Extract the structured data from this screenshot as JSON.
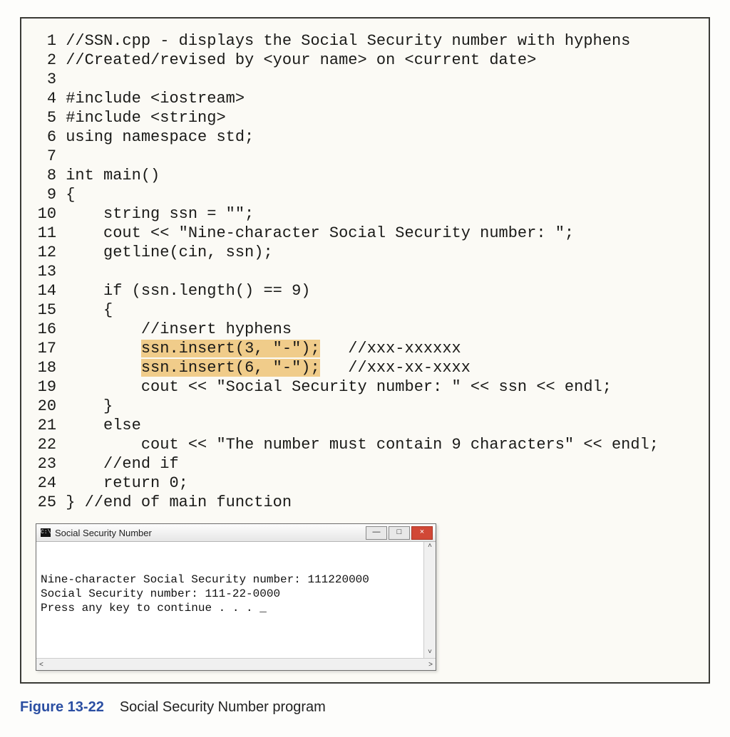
{
  "code": {
    "lines": [
      {
        "n": "1",
        "text": "//SSN.cpp - displays the Social Security number with hyphens"
      },
      {
        "n": "2",
        "text": "//Created/revised by <your name> on <current date>"
      },
      {
        "n": "3",
        "text": ""
      },
      {
        "n": "4",
        "text": "#include <iostream>"
      },
      {
        "n": "5",
        "text": "#include <string>"
      },
      {
        "n": "6",
        "text": "using namespace std;"
      },
      {
        "n": "7",
        "text": ""
      },
      {
        "n": "8",
        "text": "int main()"
      },
      {
        "n": "9",
        "text": "{"
      },
      {
        "n": "10",
        "text": "    string ssn = \"\";"
      },
      {
        "n": "11",
        "text": "    cout << \"Nine-character Social Security number: \";"
      },
      {
        "n": "12",
        "text": "    getline(cin, ssn);"
      },
      {
        "n": "13",
        "text": ""
      },
      {
        "n": "14",
        "text": "    if (ssn.length() == 9)"
      },
      {
        "n": "15",
        "text": "    {"
      },
      {
        "n": "16",
        "text": "        //insert hyphens"
      },
      {
        "n": "17",
        "pre": "        ",
        "hl": "ssn.insert(3, \"-\");",
        "post": "   //xxx-xxxxxx"
      },
      {
        "n": "18",
        "pre": "        ",
        "hl": "ssn.insert(6, \"-\");",
        "post": "   //xxx-xx-xxxx"
      },
      {
        "n": "19",
        "text": "        cout << \"Social Security number: \" << ssn << endl;"
      },
      {
        "n": "20",
        "text": "    }"
      },
      {
        "n": "21",
        "text": "    else"
      },
      {
        "n": "22",
        "text": "        cout << \"The number must contain 9 characters\" << endl;"
      },
      {
        "n": "23",
        "text": "    //end if"
      },
      {
        "n": "24",
        "text": "    return 0;"
      },
      {
        "n": "25",
        "text": "} //end of main function"
      }
    ]
  },
  "console": {
    "icon_text": "C:\\",
    "title": "Social Security Number",
    "lines": [
      "Nine-character Social Security number: 111220000",
      "Social Security number: 111-22-0000",
      "Press any key to continue . . . _"
    ],
    "buttons": {
      "min": "—",
      "max": "□",
      "close": "×"
    },
    "scroll": {
      "up": "˄",
      "down": "˅",
      "left": "<",
      "right": ">"
    }
  },
  "caption": {
    "label": "Figure 13-22",
    "text": "Social Security Number program"
  }
}
